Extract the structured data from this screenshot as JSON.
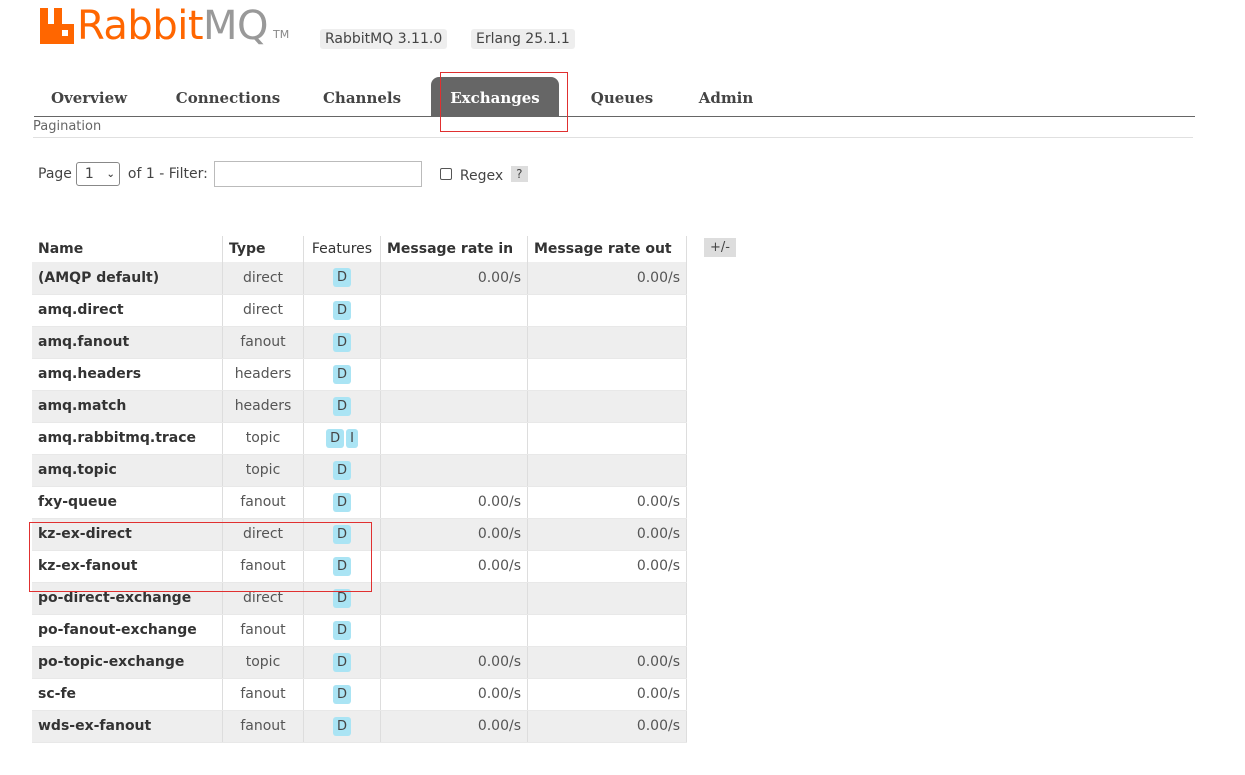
{
  "header": {
    "logo_rabbit": "Rabbit",
    "logo_mq": "MQ",
    "logo_tm": "TM",
    "version": "RabbitMQ 3.11.0",
    "erlang": "Erlang 25.1.1"
  },
  "tabs": [
    {
      "label": "Overview"
    },
    {
      "label": "Connections"
    },
    {
      "label": "Channels"
    },
    {
      "label": "Exchanges"
    },
    {
      "label": "Queues"
    },
    {
      "label": "Admin"
    }
  ],
  "active_tab": "Exchanges",
  "pagination": {
    "heading": "Pagination",
    "page_label": "Page",
    "page_value": "1",
    "of_label": "of 1  - Filter:",
    "filter_value": "",
    "regex_label": "Regex",
    "help_label": "?"
  },
  "table": {
    "columns": [
      "Name",
      "Type",
      "Features",
      "Message rate in",
      "Message rate out"
    ],
    "toggle_label": "+/-",
    "rows": [
      {
        "name": "(AMQP default)",
        "type": "direct",
        "features": [
          "D"
        ],
        "rate_in": "0.00/s",
        "rate_out": "0.00/s"
      },
      {
        "name": "amq.direct",
        "type": "direct",
        "features": [
          "D"
        ],
        "rate_in": "",
        "rate_out": ""
      },
      {
        "name": "amq.fanout",
        "type": "fanout",
        "features": [
          "D"
        ],
        "rate_in": "",
        "rate_out": ""
      },
      {
        "name": "amq.headers",
        "type": "headers",
        "features": [
          "D"
        ],
        "rate_in": "",
        "rate_out": ""
      },
      {
        "name": "amq.match",
        "type": "headers",
        "features": [
          "D"
        ],
        "rate_in": "",
        "rate_out": ""
      },
      {
        "name": "amq.rabbitmq.trace",
        "type": "topic",
        "features": [
          "D",
          "I"
        ],
        "rate_in": "",
        "rate_out": ""
      },
      {
        "name": "amq.topic",
        "type": "topic",
        "features": [
          "D"
        ],
        "rate_in": "",
        "rate_out": ""
      },
      {
        "name": "fxy-queue",
        "type": "fanout",
        "features": [
          "D"
        ],
        "rate_in": "0.00/s",
        "rate_out": "0.00/s"
      },
      {
        "name": "kz-ex-direct",
        "type": "direct",
        "features": [
          "D"
        ],
        "rate_in": "0.00/s",
        "rate_out": "0.00/s"
      },
      {
        "name": "kz-ex-fanout",
        "type": "fanout",
        "features": [
          "D"
        ],
        "rate_in": "0.00/s",
        "rate_out": "0.00/s"
      },
      {
        "name": "po-direct-exchange",
        "type": "direct",
        "features": [
          "D"
        ],
        "rate_in": "",
        "rate_out": ""
      },
      {
        "name": "po-fanout-exchange",
        "type": "fanout",
        "features": [
          "D"
        ],
        "rate_in": "",
        "rate_out": ""
      },
      {
        "name": "po-topic-exchange",
        "type": "topic",
        "features": [
          "D"
        ],
        "rate_in": "0.00/s",
        "rate_out": "0.00/s"
      },
      {
        "name": "sc-fe",
        "type": "fanout",
        "features": [
          "D"
        ],
        "rate_in": "0.00/s",
        "rate_out": "0.00/s"
      },
      {
        "name": "wds-ex-fanout",
        "type": "fanout",
        "features": [
          "D"
        ],
        "rate_in": "0.00/s",
        "rate_out": "0.00/s"
      }
    ]
  },
  "colors": {
    "brand": "#ff6600",
    "active_tab": "#666666",
    "badge": "#aae4f4",
    "highlight": "#e03030"
  }
}
